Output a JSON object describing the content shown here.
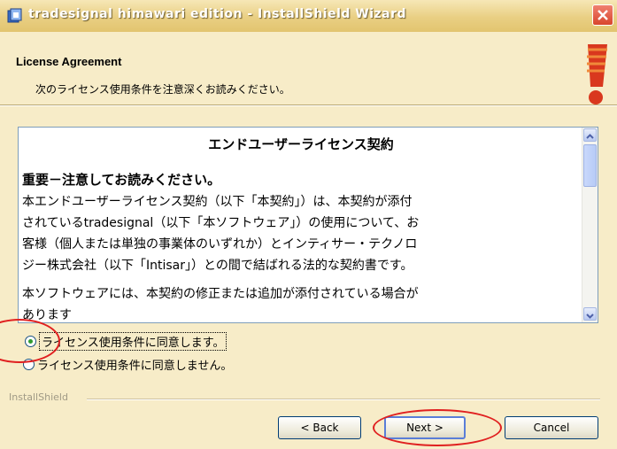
{
  "window": {
    "title": "tradesignal himawari edition - InstallShield Wizard"
  },
  "header": {
    "title": "License Agreement",
    "subtitle": "次のライセンス使用条件を注意深くお読みください。"
  },
  "license": {
    "title": "エンドユーザーライセンス契約",
    "heading": "重要－注意してお読みください。",
    "p1": [
      "本エンドユーザーライセンス契約（以下「本契約」）は、本契約が添付",
      "されているtradesignal（以下「本ソフトウェア」）の使用について、お",
      "客様（個人または単独の事業体のいずれか）とインティサー・テクノロ",
      "ジー株式会社（以下「Intisar」）との間で結ばれる法的な契約書です。"
    ],
    "p2": [
      "本ソフトウェアには、本契約の修正または追加が添付されている場合が",
      "あります"
    ]
  },
  "options": {
    "accept": "ライセンス使用条件に同意します。",
    "decline": "ライセンス使用条件に同意しません。",
    "selected": "accept"
  },
  "footer": {
    "group_label": "InstallShield"
  },
  "buttons": {
    "back": "< Back",
    "next": "Next >",
    "cancel": "Cancel"
  },
  "colors": {
    "accent": "#e02020",
    "dialog_bg": "#f7ecc8"
  }
}
